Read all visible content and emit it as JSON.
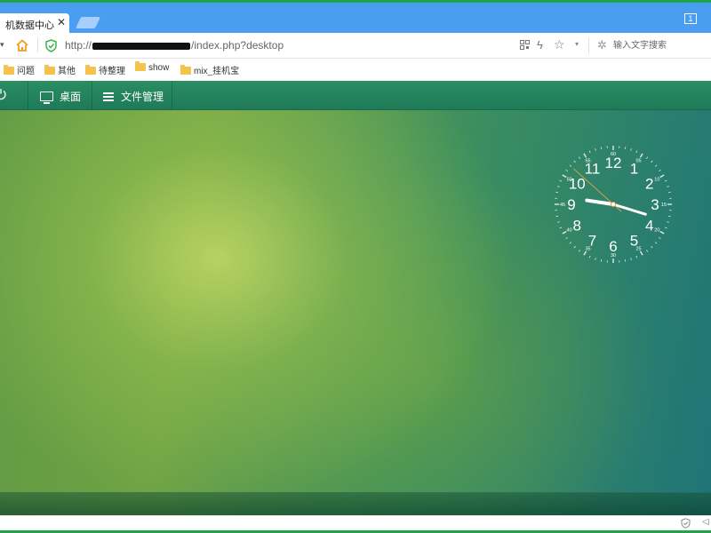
{
  "browser": {
    "tab": {
      "title": "机数据中心 - P",
      "close_glyph": "✕"
    },
    "window_button": "1",
    "address": {
      "url_prefix": "http://",
      "url_suffix": "/index.php?desktop"
    },
    "search": {
      "placeholder": "输入文字搜索"
    },
    "bookmarks": [
      {
        "label": "问题"
      },
      {
        "label": "其他"
      },
      {
        "label": "待整理"
      },
      {
        "label": "show"
      },
      {
        "label": "mix_挂机宝"
      }
    ]
  },
  "app": {
    "toolbar": {
      "desktop_label": "桌面",
      "files_label": "文件管理"
    },
    "clock": {
      "hour_numbers": [
        "12",
        "1",
        "2",
        "3",
        "4",
        "5",
        "6",
        "7",
        "8",
        "9",
        "10",
        "11"
      ],
      "minute_numbers": [
        "60",
        "05",
        "10",
        "15",
        "20",
        "25",
        "30",
        "35",
        "40",
        "45",
        "50",
        "55"
      ],
      "time": {
        "hour": 9,
        "minute": 17,
        "second": 52
      },
      "colors": {
        "face": "#ffffff",
        "second_hand": "#d8a040"
      }
    }
  },
  "colors": {
    "frame": "#20a44a",
    "tabstrip": "#4a9ef1",
    "app_toolbar": "#2a8e63"
  },
  "icons": {
    "home": "home-icon",
    "shield": "shield-icon",
    "qr": "qr-code-icon",
    "bolt": "lightning-icon",
    "star": "star-icon",
    "power": "power-icon",
    "folder": "folder-icon"
  }
}
